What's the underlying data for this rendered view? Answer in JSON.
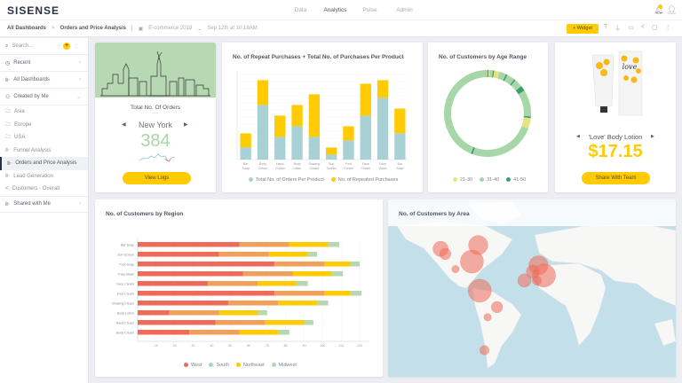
{
  "app": {
    "logo": "SISENSE",
    "nav": [
      "Data",
      "Analytics",
      "Pulse",
      "Admin"
    ],
    "active_nav": "Analytics",
    "notification_count": "5"
  },
  "breadcrumb": {
    "root": "All Dashboards",
    "sep": ">",
    "current": "Orders and Price Analysis",
    "datasource": "E-commerce 2018",
    "updated": "Sep 12th at 10:18AM"
  },
  "toolbar": {
    "widget_label": "+ Widget",
    "tools": [
      "text-icon",
      "filter-icon",
      "image-icon",
      "share-icon",
      "screen-icon",
      "more-icon"
    ]
  },
  "sidebar": {
    "search_placeholder": "Search...",
    "sections": {
      "recent": "Recent",
      "all": "All Dashboards",
      "created": "Created by Me",
      "shared": "Shared with Me"
    },
    "items": [
      {
        "label": "Asia",
        "icon": "folder"
      },
      {
        "label": "Europe",
        "icon": "folder"
      },
      {
        "label": "USA",
        "icon": "folder"
      },
      {
        "label": "Funnel Analysis",
        "icon": "dashboard"
      },
      {
        "label": "Orders and Price Analysis",
        "icon": "dashboard",
        "selected": true
      },
      {
        "label": "Lead Generation",
        "icon": "dashboard"
      },
      {
        "label": "Customers - Overall",
        "icon": "share"
      }
    ]
  },
  "orders": {
    "title": "Total No. Of Orders",
    "sep": "—",
    "city": "New York",
    "value": "384",
    "button": "View Logs"
  },
  "product": {
    "name": "'Love' Body Lotion",
    "price": "$17.15",
    "button": "Share With Team",
    "logo_text": "love"
  },
  "colors": {
    "accent": "#ffcb05",
    "teal": "#a8d1d6",
    "green": "#a7d7a9",
    "west": "#ee6b5a",
    "south_bar": "#f0a05a",
    "south_legend": "#a8d1d6",
    "midwest": "#b5d8b0"
  },
  "chart_data": [
    {
      "type": "bar",
      "stacked": true,
      "title": "No. of Repeat Purchases + Total No. of Purchases Per Product",
      "categories": [
        "Bar Soap",
        "Body Cream",
        "Hand Cream",
        "Body Lotion",
        "Shaving Cream",
        "Sun Screen",
        "Foot Cream",
        "Face Cream",
        "Face Wash",
        "Bar Soap"
      ],
      "series": [
        {
          "name": "Total No. of Orders Per Product",
          "color": "#a8d1d6",
          "values": [
            1.7,
            7.7,
            3.2,
            4.7,
            3.2,
            0.7,
            2.7,
            6.2,
            8.7,
            3.7
          ]
        },
        {
          "name": "No. of Repeated Purchases",
          "color": "#ffcb05",
          "values": [
            2.0,
            3.5,
            3.0,
            3.0,
            6.0,
            1.0,
            2.0,
            4.5,
            2.5,
            3.5
          ]
        }
      ],
      "ylim": [
        0,
        12
      ],
      "grid": true,
      "legend": "bottom"
    },
    {
      "type": "pie",
      "donut": true,
      "title": "No. of Customers by Age Range",
      "legend": "bottom",
      "categories": [
        "21-30",
        "31-40",
        "41-50"
      ],
      "colors": [
        "#e3e680",
        "#a7d7a9",
        "#3f9e6d"
      ],
      "segments": [
        [
          "41-50",
          0.4
        ],
        [
          "21-30",
          0.4
        ],
        [
          "31-40",
          1.2
        ],
        [
          "41-50",
          0.5
        ],
        [
          "21-30",
          2
        ],
        [
          "31-40",
          2.5
        ],
        [
          "41-50",
          0.6
        ],
        [
          "31-40",
          3
        ],
        [
          "41-50",
          0.6
        ],
        [
          "31-40",
          3
        ],
        [
          "41-50",
          2
        ],
        [
          "31-40",
          10
        ],
        [
          "41-50",
          0.6
        ],
        [
          "21-30",
          4
        ],
        [
          "31-40",
          25
        ],
        [
          "41-50",
          0.7
        ],
        [
          "31-40",
          43.9
        ]
      ]
    },
    {
      "type": "bar",
      "orientation": "horizontal",
      "stacked": true,
      "title": "No. of Customers by Region",
      "categories": [
        "Bar Soap",
        "Sun Screen",
        "Foot Soap",
        "Face Mask",
        "Face Cream",
        "Foot Cream",
        "Shaving Cream",
        "Body Lotion",
        "Hand Cream",
        "Body Cream"
      ],
      "xticks": [
        10,
        20,
        30,
        40,
        50,
        60,
        70,
        80,
        90,
        100,
        110,
        120
      ],
      "xlim": [
        0,
        125
      ],
      "legend": "bottom",
      "series": [
        {
          "name": "West",
          "values": [
            55,
            44,
            74,
            57,
            38,
            74,
            49,
            17,
            42,
            28
          ]
        },
        {
          "name": "South",
          "values": [
            27,
            27,
            27,
            27,
            27,
            27,
            27,
            27,
            27,
            27
          ]
        },
        {
          "name": "Northeast",
          "values": [
            21,
            21,
            14,
            21,
            21,
            14,
            21,
            21,
            21,
            21
          ]
        },
        {
          "name": "Midwest",
          "values": [
            6,
            5,
            5,
            6,
            6,
            6,
            6,
            5,
            5,
            6
          ]
        }
      ]
    },
    {
      "type": "scatter",
      "map": true,
      "title": "No. of Customers by Area",
      "points": [
        {
          "lon": -122,
          "lat": 38,
          "size": 3
        },
        {
          "lon": -116,
          "lat": 34,
          "size": 2
        },
        {
          "lon": -103,
          "lat": 22,
          "size": 1
        },
        {
          "lon": -74,
          "lat": 41,
          "size": 4
        },
        {
          "lon": -82,
          "lat": 28,
          "size": 5
        },
        {
          "lon": -72,
          "lat": 5,
          "size": 5
        },
        {
          "lon": -50,
          "lat": -8,
          "size": 2
        },
        {
          "lon": -62,
          "lat": -16,
          "size": 1
        },
        {
          "lon": -66,
          "lat": -42,
          "size": 1.5
        },
        {
          "lon": -15,
          "lat": 13,
          "size": 2.5
        },
        {
          "lon": -4,
          "lat": 20,
          "size": 2.5
        },
        {
          "lon": 3,
          "lat": 25,
          "size": 4
        },
        {
          "lon": 1,
          "lat": 13,
          "size": 1.5
        },
        {
          "lon": 10,
          "lat": 17,
          "size": 5
        }
      ]
    }
  ]
}
